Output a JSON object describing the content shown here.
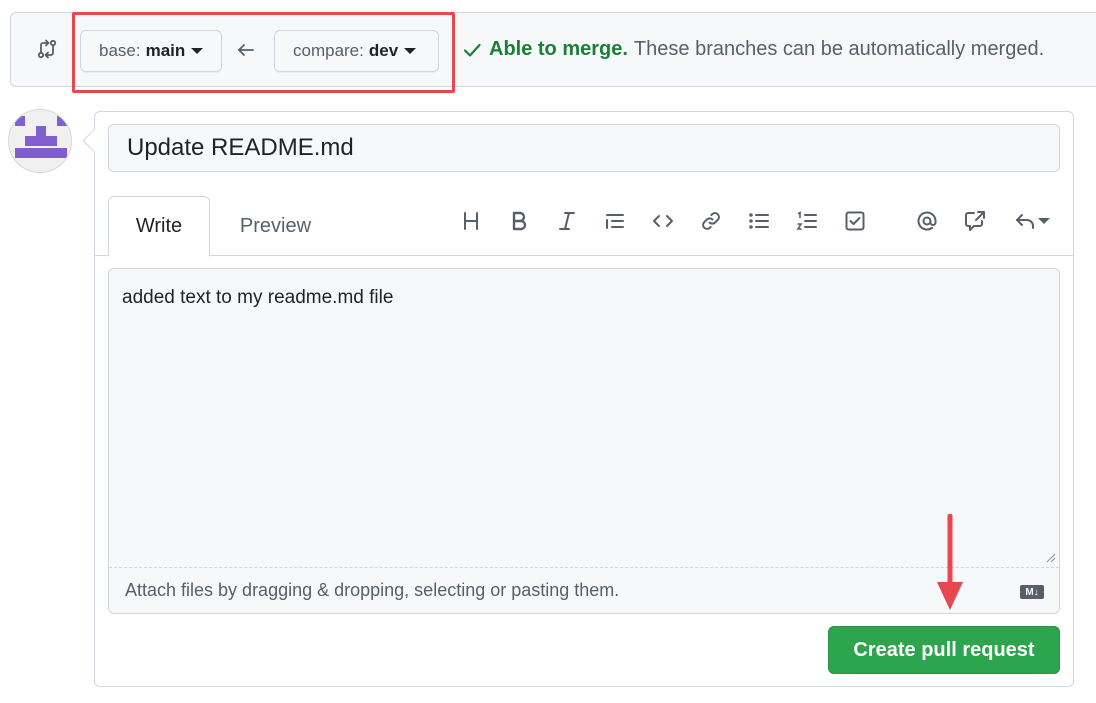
{
  "compare": {
    "base_prefix": "base:",
    "base_branch": "main",
    "compare_prefix": "compare:",
    "compare_branch": "dev",
    "merge_ok": "Able to merge.",
    "merge_desc": "These branches can be automatically merged."
  },
  "form": {
    "title_value": "Update README.md",
    "tabs": [
      {
        "label": "Write",
        "active": true
      },
      {
        "label": "Preview",
        "active": false
      }
    ],
    "body_text": "added text to my readme.md file",
    "attach_hint": "Attach files by dragging & dropping, selecting or pasting them.",
    "markdown_badge": "M↓",
    "submit_label": "Create pull request"
  },
  "toolbar_icons": [
    "heading-icon",
    "bold-icon",
    "italic-icon",
    "quote-icon",
    "code-icon",
    "link-icon",
    "bulleted-list-icon",
    "numbered-list-icon",
    "task-list-icon",
    "mention-icon",
    "reference-icon",
    "saved-replies-icon"
  ],
  "colors": {
    "success": "#1a7f37",
    "button_green": "#2da44e",
    "annotation_red": "#e5484d",
    "avatar_purple": "#8060d0"
  }
}
